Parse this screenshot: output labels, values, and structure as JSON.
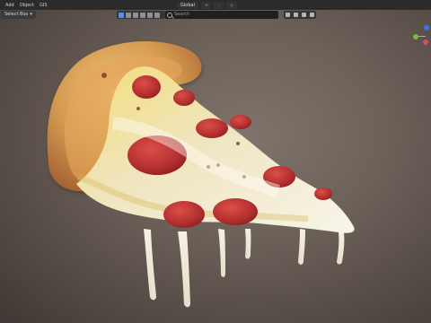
{
  "menu": {
    "items": [
      "Add",
      "Object",
      "GIS"
    ]
  },
  "header": {
    "mode": "Select Box",
    "global_label": "Global",
    "search_placeholder": "Search"
  },
  "icons": {
    "search": "search-icon",
    "gizmo": "axis-gizmo-icon"
  },
  "colors": {
    "menubar": "#2b2b2b",
    "viewport": "#6c625a",
    "accent": "#5b8cf0"
  }
}
